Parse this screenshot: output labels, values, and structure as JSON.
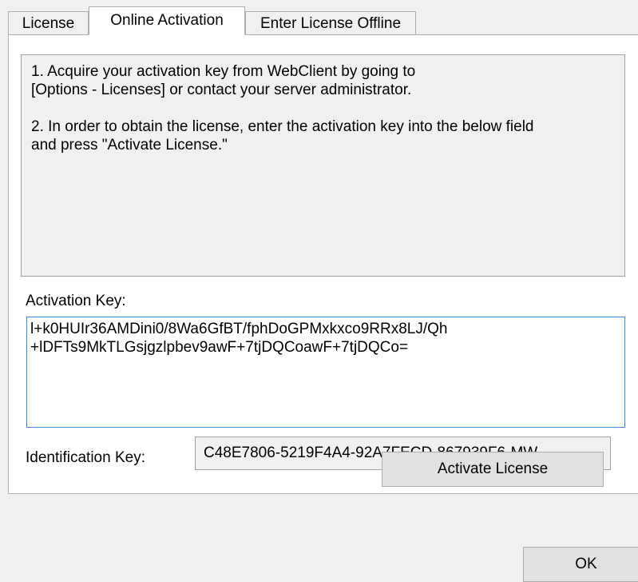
{
  "tabs": [
    {
      "label": "License"
    },
    {
      "label": "Online Activation"
    },
    {
      "label": "Enter License Offline"
    }
  ],
  "active_tab": "Online Activation",
  "instructions": {
    "step1": "1. Acquire your activation key from WebClient by going to\n[Options - Licenses]  or contact your server administrator.",
    "step2": "2. In order to obtain the license, enter the activation key into the below field\nand press \"Activate License.\""
  },
  "activation_key": {
    "label": "Activation Key:",
    "value": "l+k0HUIr36AMDini0/8Wa6GfBT/fphDoGPMxkxco9RRx8LJ/Qh\n+lDFTs9MkTLGsjgzlpbev9awF+7tjDQCoawF+7tjDQCo="
  },
  "identification_key": {
    "label": "Identification Key:",
    "value": "C48E7806-5219F4A4-92A7FECD-867939F6-MW"
  },
  "buttons": {
    "activate": "Activate License",
    "ok": "OK"
  }
}
